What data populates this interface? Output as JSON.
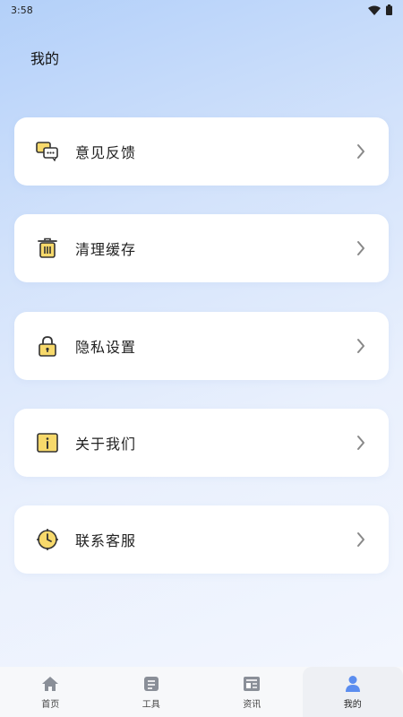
{
  "status_bar": {
    "time": "3:58"
  },
  "header": {
    "title": "我的"
  },
  "menu": {
    "items": [
      {
        "label": "意见反馈",
        "icon": "feedback-icon"
      },
      {
        "label": "清理缓存",
        "icon": "trash-icon"
      },
      {
        "label": "隐私设置",
        "icon": "lock-icon"
      },
      {
        "label": "关于我们",
        "icon": "info-icon"
      },
      {
        "label": "联系客服",
        "icon": "clock-icon"
      }
    ]
  },
  "nav": {
    "items": [
      {
        "label": "首页",
        "icon": "home-icon"
      },
      {
        "label": "工具",
        "icon": "tools-icon"
      },
      {
        "label": "资讯",
        "icon": "news-icon"
      },
      {
        "label": "我的",
        "icon": "profile-icon",
        "active": true
      }
    ]
  },
  "colors": {
    "accent": "#5b8def",
    "icon_fill": "#f7d96b",
    "icon_stroke": "#333333"
  }
}
